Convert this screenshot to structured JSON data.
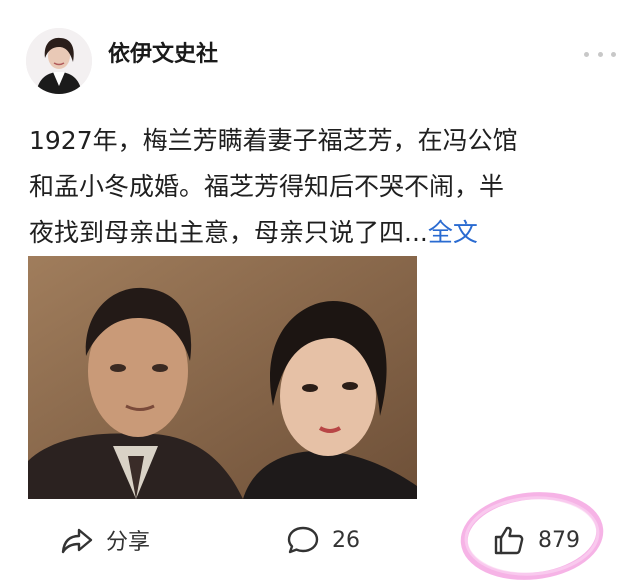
{
  "author": {
    "name": "依伊文史社",
    "avatar_icon": "author-avatar"
  },
  "post": {
    "text_lines": [
      "1927年，梅兰芳瞒着妻子福芝芳，在冯公馆",
      "和孟小冬成婚。福芝芳得知后不哭不闹，半",
      "夜找到母亲出主意，母亲只说了四..."
    ],
    "read_more_label": "全文"
  },
  "actions": {
    "share_label": "分享",
    "comment_count": "26",
    "like_count": "879"
  },
  "icons": {
    "more": "more-dots-icon",
    "share": "share-icon",
    "comment": "comment-icon",
    "like": "thumbs-up-icon"
  },
  "colors": {
    "read_more": "#2a6bd1",
    "highlight": "#f4a6e2"
  }
}
